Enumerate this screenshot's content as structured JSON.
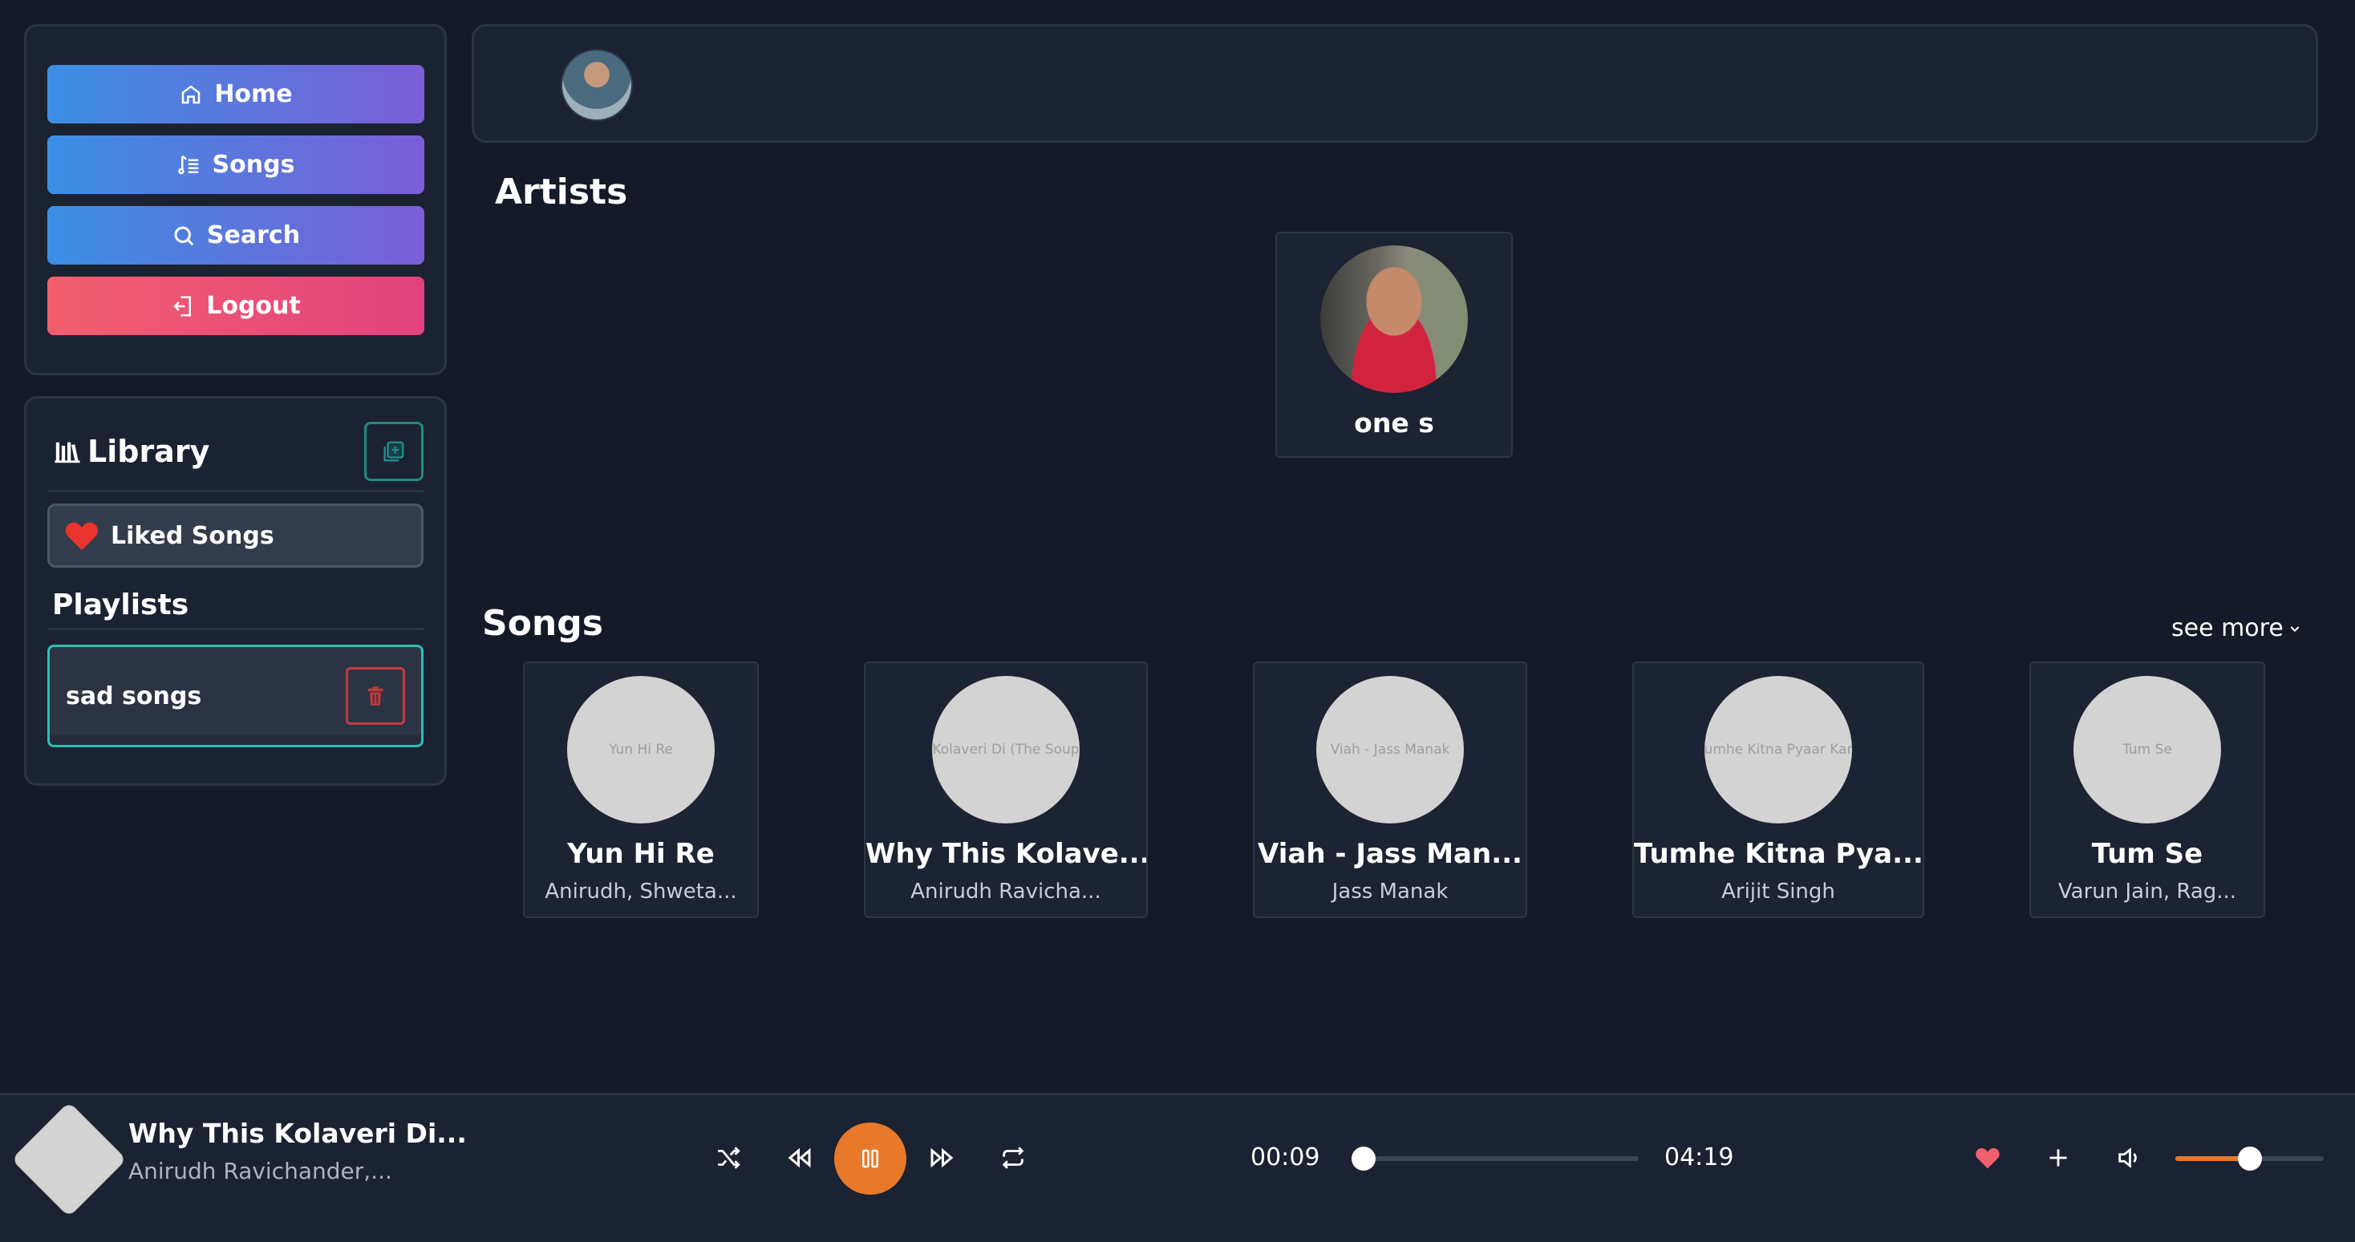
{
  "sidebar": {
    "nav": [
      {
        "label": "Home",
        "icon": "home-icon"
      },
      {
        "label": "Songs",
        "icon": "music-list-icon"
      },
      {
        "label": "Search",
        "icon": "search-icon"
      },
      {
        "label": "Logout",
        "icon": "logout-icon"
      }
    ],
    "library": {
      "title": "Library",
      "liked_label": "Liked Songs",
      "playlists_title": "Playlists",
      "playlists": [
        {
          "name": "sad songs"
        }
      ]
    }
  },
  "artists": {
    "title": "Artists",
    "items": [
      {
        "name": "one s"
      }
    ]
  },
  "songs": {
    "title": "Songs",
    "see_more": "see more",
    "items": [
      {
        "title": "Yun Hi Re",
        "artist": "Anirudh, Shweta...",
        "cover_text": "Yun Hi Re"
      },
      {
        "title": "Why This Kolave...",
        "artist": "Anirudh Ravicha...",
        "cover_text": "Kolaveri Di (The Soup"
      },
      {
        "title": "Viah - Jass Man...",
        "artist": "Jass Manak",
        "cover_text": "Viah - Jass Manak"
      },
      {
        "title": "Tumhe Kitna Pya...",
        "artist": "Arijit Singh",
        "cover_text": "umhe Kitna Pyaar Kar"
      },
      {
        "title": "Tum Se",
        "artist": "Varun Jain, Rag...",
        "cover_text": "Tum Se"
      }
    ]
  },
  "player": {
    "title": "Why This Kolaveri Di...",
    "artist": "Anirudh Ravichander,...",
    "current_time": "00:09",
    "total_time": "04:19",
    "progress": 0.035,
    "volume": 0.5,
    "liked": true,
    "colors": {
      "accent": "#e8782a",
      "liked": "#f25f6d"
    }
  }
}
